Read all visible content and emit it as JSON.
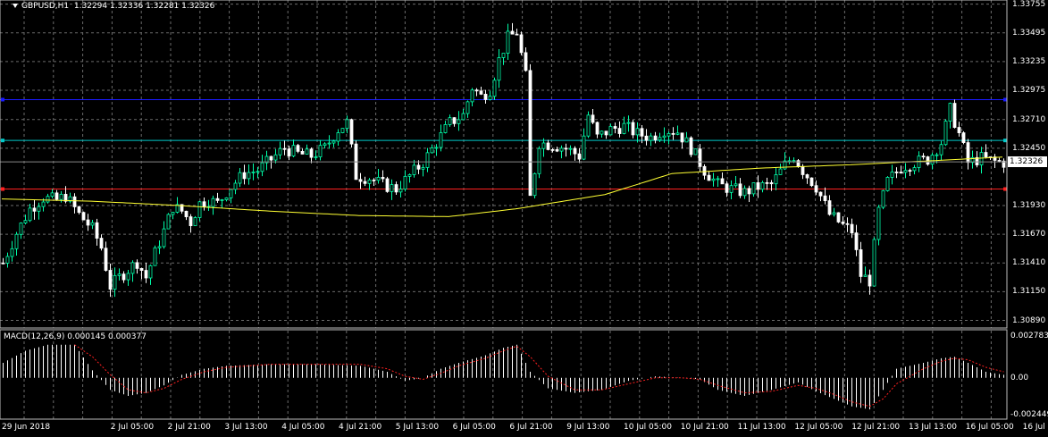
{
  "header": {
    "symbol_label": "GBPUSD,H1",
    "ohlc": "1.32294 1.32336 1.32281 1.32326"
  },
  "macd": {
    "label": "MACD(12,26,9) 0.000145 0.000377",
    "axis": [
      "0.002783",
      "0.00",
      "-0.002449"
    ]
  },
  "price_axis": [
    "1.33755",
    "1.33495",
    "1.33235",
    "1.32975",
    "1.32710",
    "1.32450",
    "1.31930",
    "1.31670",
    "1.31410",
    "1.31150",
    "1.30890"
  ],
  "current_price": "1.32326",
  "time_axis": [
    "29 Jun 2018",
    "2 Jul 05:00",
    "2 Jul 21:00",
    "3 Jul 13:00",
    "4 Jul 05:00",
    "4 Jul 21:00",
    "5 Jul 13:00",
    "6 Jul 05:00",
    "6 Jul 21:00",
    "9 Jul 13:00",
    "10 Jul 05:00",
    "10 Jul 21:00",
    "11 Jul 13:00",
    "12 Jul 05:00",
    "12 Jul 21:00",
    "13 Jul 13:00",
    "16 Jul 05:00",
    "16 Jul 21:00"
  ],
  "colors": {
    "background": "#000000",
    "grid": "#6b6b6b",
    "bull": "#00ffaa",
    "bear": "#ffffff",
    "ma": "#ffff33",
    "hline_blue": "#1a1aff",
    "hline_cyan": "#00c8c8",
    "hline_red": "#ff2020",
    "signal": "#ff2020",
    "histogram": "#ffffff"
  },
  "chart_data": {
    "type": "candlestick",
    "title": "GBPUSD,H1",
    "ylim": [
      1.3087,
      1.3376
    ],
    "horizontal_lines": [
      1.3289,
      1.3252,
      1.3208
    ],
    "close_path": [
      [
        0,
        1.3141
      ],
      [
        3,
        1.3168
      ],
      [
        6,
        1.319
      ],
      [
        9,
        1.32
      ],
      [
        12,
        1.3198
      ],
      [
        14,
        1.3202
      ],
      [
        17,
        1.3185
      ],
      [
        20,
        1.3172
      ],
      [
        22,
        1.3155
      ],
      [
        24,
        1.312
      ],
      [
        26,
        1.3128
      ],
      [
        28,
        1.3135
      ],
      [
        30,
        1.3142
      ],
      [
        32,
        1.3128
      ],
      [
        34,
        1.315
      ],
      [
        36,
        1.317
      ],
      [
        38,
        1.3192
      ],
      [
        40,
        1.3188
      ],
      [
        42,
        1.3178
      ],
      [
        44,
        1.3195
      ],
      [
        46,
        1.3198
      ],
      [
        48,
        1.3195
      ],
      [
        51,
        1.321
      ],
      [
        54,
        1.3222
      ],
      [
        57,
        1.3225
      ],
      [
        60,
        1.3235
      ],
      [
        63,
        1.3245
      ],
      [
        66,
        1.324
      ],
      [
        69,
        1.3238
      ],
      [
        72,
        1.3245
      ],
      [
        75,
        1.3262
      ],
      [
        77,
        1.3268
      ],
      [
        79,
        1.322
      ],
      [
        82,
        1.3218
      ],
      [
        85,
        1.3212
      ],
      [
        88,
        1.3208
      ],
      [
        91,
        1.322
      ],
      [
        94,
        1.3232
      ],
      [
        97,
        1.325
      ],
      [
        100,
        1.3268
      ],
      [
        103,
        1.3275
      ],
      [
        105,
        1.33
      ],
      [
        107,
        1.3292
      ],
      [
        109,
        1.3298
      ],
      [
        111,
        1.3325
      ],
      [
        113,
        1.3345
      ],
      [
        115,
        1.335
      ],
      [
        117,
        1.331
      ],
      [
        118,
        1.32
      ],
      [
        120,
        1.325
      ],
      [
        123,
        1.3248
      ],
      [
        126,
        1.3245
      ],
      [
        129,
        1.3238
      ],
      [
        131,
        1.3275
      ],
      [
        133,
        1.3255
      ],
      [
        136,
        1.3262
      ],
      [
        139,
        1.3265
      ],
      [
        142,
        1.3258
      ],
      [
        145,
        1.3255
      ],
      [
        148,
        1.3262
      ],
      [
        151,
        1.326
      ],
      [
        154,
        1.3245
      ],
      [
        157,
        1.3225
      ],
      [
        160,
        1.3212
      ],
      [
        163,
        1.3208
      ],
      [
        166,
        1.3205
      ],
      [
        169,
        1.321
      ],
      [
        172,
        1.3212
      ],
      [
        175,
        1.323
      ],
      [
        177,
        1.3238
      ],
      [
        179,
        1.3225
      ],
      [
        182,
        1.321
      ],
      [
        185,
        1.3185
      ],
      [
        188,
        1.3175
      ],
      [
        190,
        1.317
      ],
      [
        192,
        1.313
      ],
      [
        194,
        1.3125
      ],
      [
        196,
        1.3188
      ],
      [
        198,
        1.3215
      ],
      [
        201,
        1.3228
      ],
      [
        204,
        1.3232
      ],
      [
        207,
        1.3235
      ],
      [
        210,
        1.325
      ],
      [
        212,
        1.328
      ],
      [
        214,
        1.3258
      ],
      [
        216,
        1.3232
      ],
      [
        219,
        1.3236
      ],
      [
        222,
        1.3233
      ],
      [
        224,
        1.3232
      ]
    ],
    "moving_average_path": [
      [
        0,
        1.3199
      ],
      [
        20,
        1.3197
      ],
      [
        40,
        1.3193
      ],
      [
        60,
        1.3188
      ],
      [
        80,
        1.3184
      ],
      [
        100,
        1.3183
      ],
      [
        115,
        1.319
      ],
      [
        135,
        1.3203
      ],
      [
        150,
        1.3222
      ],
      [
        170,
        1.3227
      ],
      [
        190,
        1.323
      ],
      [
        210,
        1.3234
      ],
      [
        224,
        1.3237
      ]
    ],
    "macd_ylim": [
      -0.00245,
      0.00278
    ],
    "macd_histogram_path": [
      [
        0,
        0.001
      ],
      [
        5,
        0.0018
      ],
      [
        10,
        0.0022
      ],
      [
        16,
        0.0022
      ],
      [
        20,
        0.0005
      ],
      [
        24,
        -0.0008
      ],
      [
        28,
        -0.0012
      ],
      [
        32,
        -0.001
      ],
      [
        36,
        -0.0005
      ],
      [
        40,
        0.0002
      ],
      [
        45,
        0.0006
      ],
      [
        50,
        0.0008
      ],
      [
        60,
        0.0009
      ],
      [
        70,
        0.0009
      ],
      [
        80,
        0.0008
      ],
      [
        86,
        0.0004
      ],
      [
        90,
        -0.0002
      ],
      [
        94,
        0.0
      ],
      [
        98,
        0.0006
      ],
      [
        102,
        0.001
      ],
      [
        108,
        0.0015
      ],
      [
        112,
        0.002
      ],
      [
        115,
        0.0022
      ],
      [
        118,
        0.0004
      ],
      [
        122,
        -0.0007
      ],
      [
        128,
        -0.001
      ],
      [
        134,
        -0.0008
      ],
      [
        140,
        -0.0002
      ],
      [
        146,
        0.0001
      ],
      [
        152,
        0.0
      ],
      [
        156,
        -0.0001
      ],
      [
        160,
        -0.0008
      ],
      [
        166,
        -0.0012
      ],
      [
        172,
        -0.0008
      ],
      [
        178,
        -0.0003
      ],
      [
        182,
        -0.0009
      ],
      [
        186,
        -0.0014
      ],
      [
        190,
        -0.0019
      ],
      [
        194,
        -0.0021
      ],
      [
        197,
        -0.0008
      ],
      [
        200,
        0.0006
      ],
      [
        206,
        0.001
      ],
      [
        210,
        0.0013
      ],
      [
        213,
        0.0014
      ],
      [
        216,
        0.001
      ],
      [
        220,
        0.0004
      ],
      [
        224,
        0.0002
      ]
    ],
    "macd_signal_path": [
      [
        16,
        0.0022
      ],
      [
        20,
        0.0014
      ],
      [
        24,
        0.0002
      ],
      [
        28,
        -0.0008
      ],
      [
        32,
        -0.001
      ],
      [
        36,
        -0.0007
      ],
      [
        40,
        -0.0001
      ],
      [
        45,
        0.0004
      ],
      [
        50,
        0.0007
      ],
      [
        60,
        0.0009
      ],
      [
        70,
        0.0009
      ],
      [
        80,
        0.0009
      ],
      [
        86,
        0.0006
      ],
      [
        90,
        0.0001
      ],
      [
        94,
        -0.0001
      ],
      [
        98,
        0.0003
      ],
      [
        102,
        0.0008
      ],
      [
        108,
        0.0013
      ],
      [
        112,
        0.0018
      ],
      [
        115,
        0.0021
      ],
      [
        118,
        0.0014
      ],
      [
        122,
        0.0001
      ],
      [
        128,
        -0.0008
      ],
      [
        134,
        -0.0008
      ],
      [
        140,
        -0.0004
      ],
      [
        146,
        0.0
      ],
      [
        152,
        0.0
      ],
      [
        156,
        -0.0001
      ],
      [
        160,
        -0.0005
      ],
      [
        166,
        -0.001
      ],
      [
        172,
        -0.0009
      ],
      [
        178,
        -0.0005
      ],
      [
        182,
        -0.0007
      ],
      [
        186,
        -0.0011
      ],
      [
        190,
        -0.0016
      ],
      [
        194,
        -0.0019
      ],
      [
        197,
        -0.0014
      ],
      [
        200,
        -0.0004
      ],
      [
        206,
        0.0006
      ],
      [
        210,
        0.0011
      ],
      [
        213,
        0.0013
      ],
      [
        216,
        0.0012
      ],
      [
        220,
        0.0007
      ],
      [
        224,
        0.0004
      ]
    ]
  }
}
